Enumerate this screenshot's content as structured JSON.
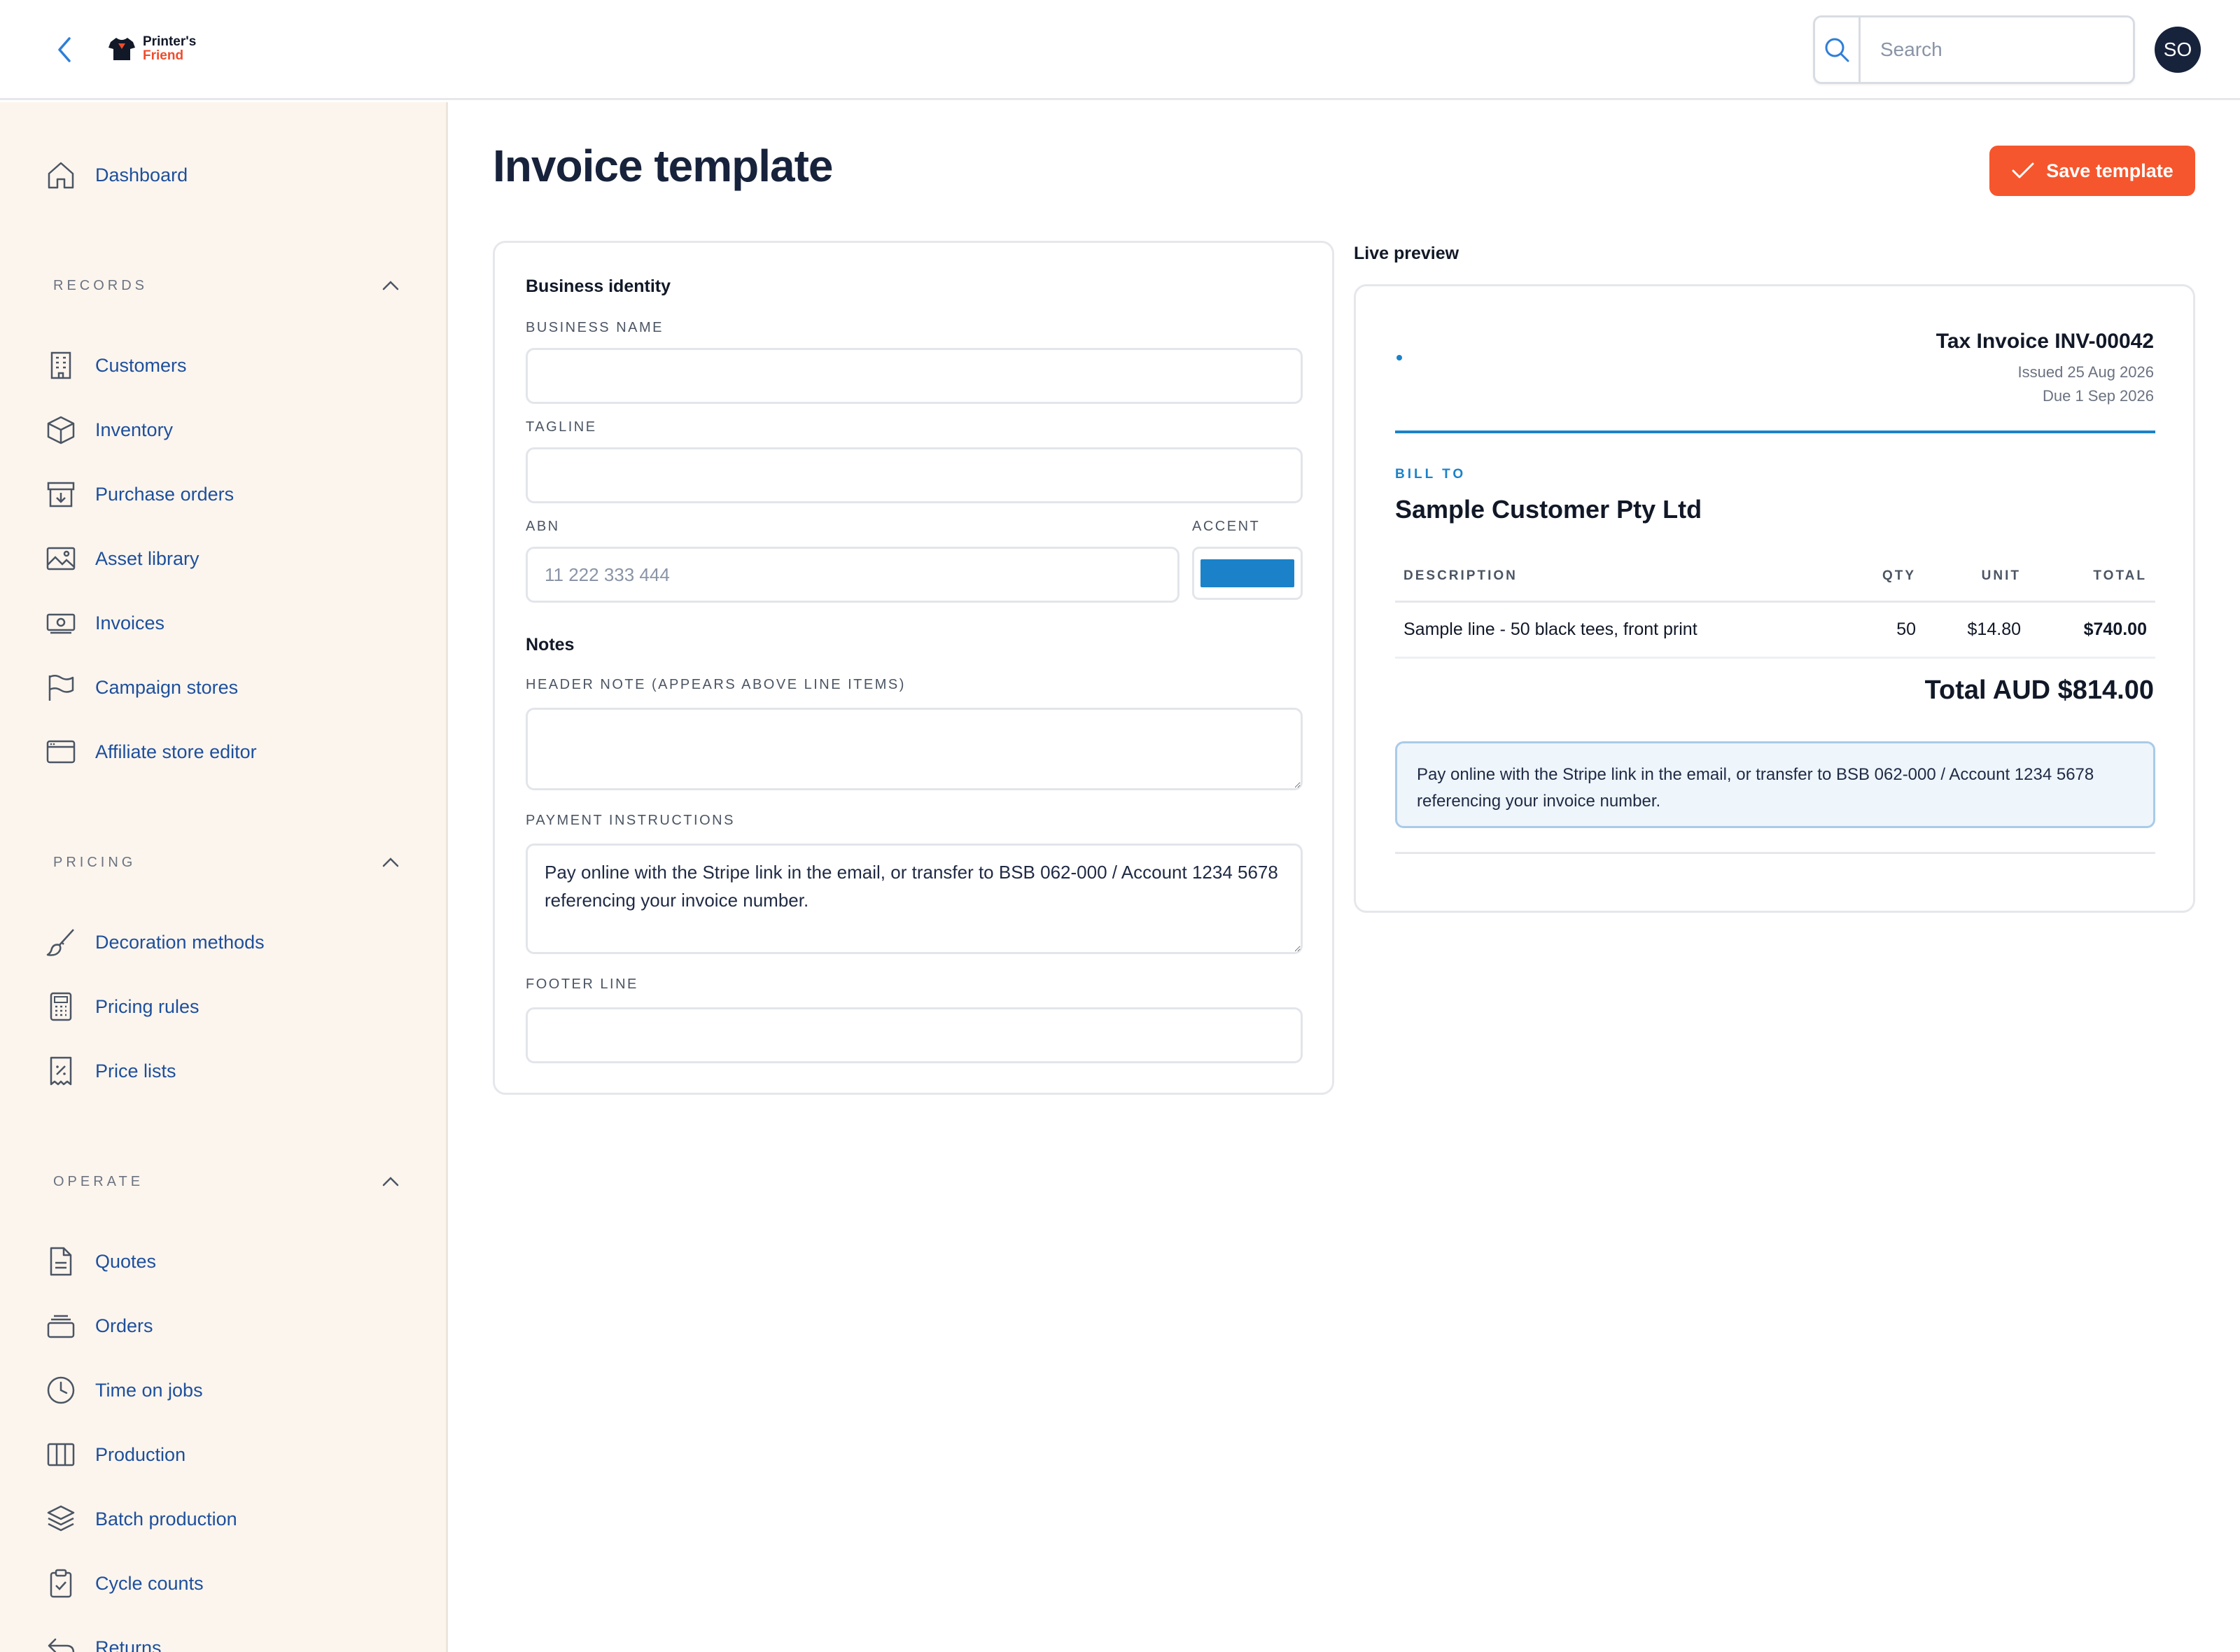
{
  "brand": {
    "line1": "Printer's",
    "line2": "Friend"
  },
  "search": {
    "placeholder": "Search"
  },
  "user": {
    "initials": "SO"
  },
  "sidebar": {
    "top_items": [
      {
        "label": "Dashboard",
        "icon": "home-icon"
      }
    ],
    "sections": [
      {
        "title": "RECORDS",
        "items": [
          {
            "label": "Customers",
            "icon": "building-icon"
          },
          {
            "label": "Inventory",
            "icon": "box-icon"
          },
          {
            "label": "Purchase orders",
            "icon": "archive-down-icon"
          },
          {
            "label": "Asset library",
            "icon": "image-icon"
          },
          {
            "label": "Invoices",
            "icon": "banknote-icon"
          },
          {
            "label": "Campaign stores",
            "icon": "flag-icon"
          },
          {
            "label": "Affiliate store editor",
            "icon": "browser-window-icon"
          }
        ]
      },
      {
        "title": "PRICING",
        "items": [
          {
            "label": "Decoration methods",
            "icon": "paintbrush-icon"
          },
          {
            "label": "Pricing rules",
            "icon": "calculator-icon"
          },
          {
            "label": "Price lists",
            "icon": "receipt-percent-icon"
          }
        ]
      },
      {
        "title": "OPERATE",
        "items": [
          {
            "label": "Quotes",
            "icon": "document-icon"
          },
          {
            "label": "Orders",
            "icon": "stack-icon"
          },
          {
            "label": "Time on jobs",
            "icon": "clock-icon"
          },
          {
            "label": "Production",
            "icon": "columns-icon"
          },
          {
            "label": "Batch production",
            "icon": "layers-icon"
          },
          {
            "label": "Cycle counts",
            "icon": "clipboard-check-icon"
          },
          {
            "label": "Returns",
            "icon": "return-arrow-icon"
          }
        ]
      }
    ]
  },
  "page": {
    "title": "Invoice template",
    "save_label": "Save template"
  },
  "form": {
    "business_identity_title": "Business identity",
    "business_name": {
      "label": "BUSINESS NAME",
      "value": "",
      "placeholder": ""
    },
    "tagline": {
      "label": "TAGLINE",
      "value": "",
      "placeholder": ""
    },
    "abn": {
      "label": "ABN",
      "value": "",
      "placeholder": "11 222 333 444"
    },
    "accent": {
      "label": "ACCENT",
      "color": "#1b82c9"
    },
    "notes_title": "Notes",
    "header_note": {
      "label": "HEADER NOTE (APPEARS ABOVE LINE ITEMS)",
      "value": ""
    },
    "payment_instructions": {
      "label": "PAYMENT INSTRUCTIONS",
      "value": "Pay online with the Stripe link in the email, or transfer to BSB 062-000 / Account 1234 5678 referencing your invoice number."
    },
    "footer_line": {
      "label": "FOOTER LINE",
      "value": ""
    }
  },
  "preview": {
    "label": "Live preview",
    "invoice_title": "Tax Invoice INV-00042",
    "issued": "Issued 25 Aug 2026",
    "due": "Due 1 Sep 2026",
    "bill_to_label": "BILL TO",
    "customer": "Sample Customer Pty Ltd",
    "columns": [
      "DESCRIPTION",
      "QTY",
      "UNIT",
      "TOTAL"
    ],
    "rows": [
      {
        "description": "Sample line - 50 black tees, front print",
        "qty": "50",
        "unit": "$14.80",
        "total": "$740.00"
      }
    ],
    "total": "Total AUD $814.00",
    "payment_note": "Pay online with the Stripe link in the email, or transfer to BSB 062-000 / Account 1234 5678 referencing your invoice number."
  },
  "colors": {
    "accent": "#1b82c9",
    "brand_orange": "#f6562d",
    "nav_text": "#1e4f9c",
    "sidebar_bg": "#fbf5ee",
    "avatar_bg": "#17223b"
  }
}
